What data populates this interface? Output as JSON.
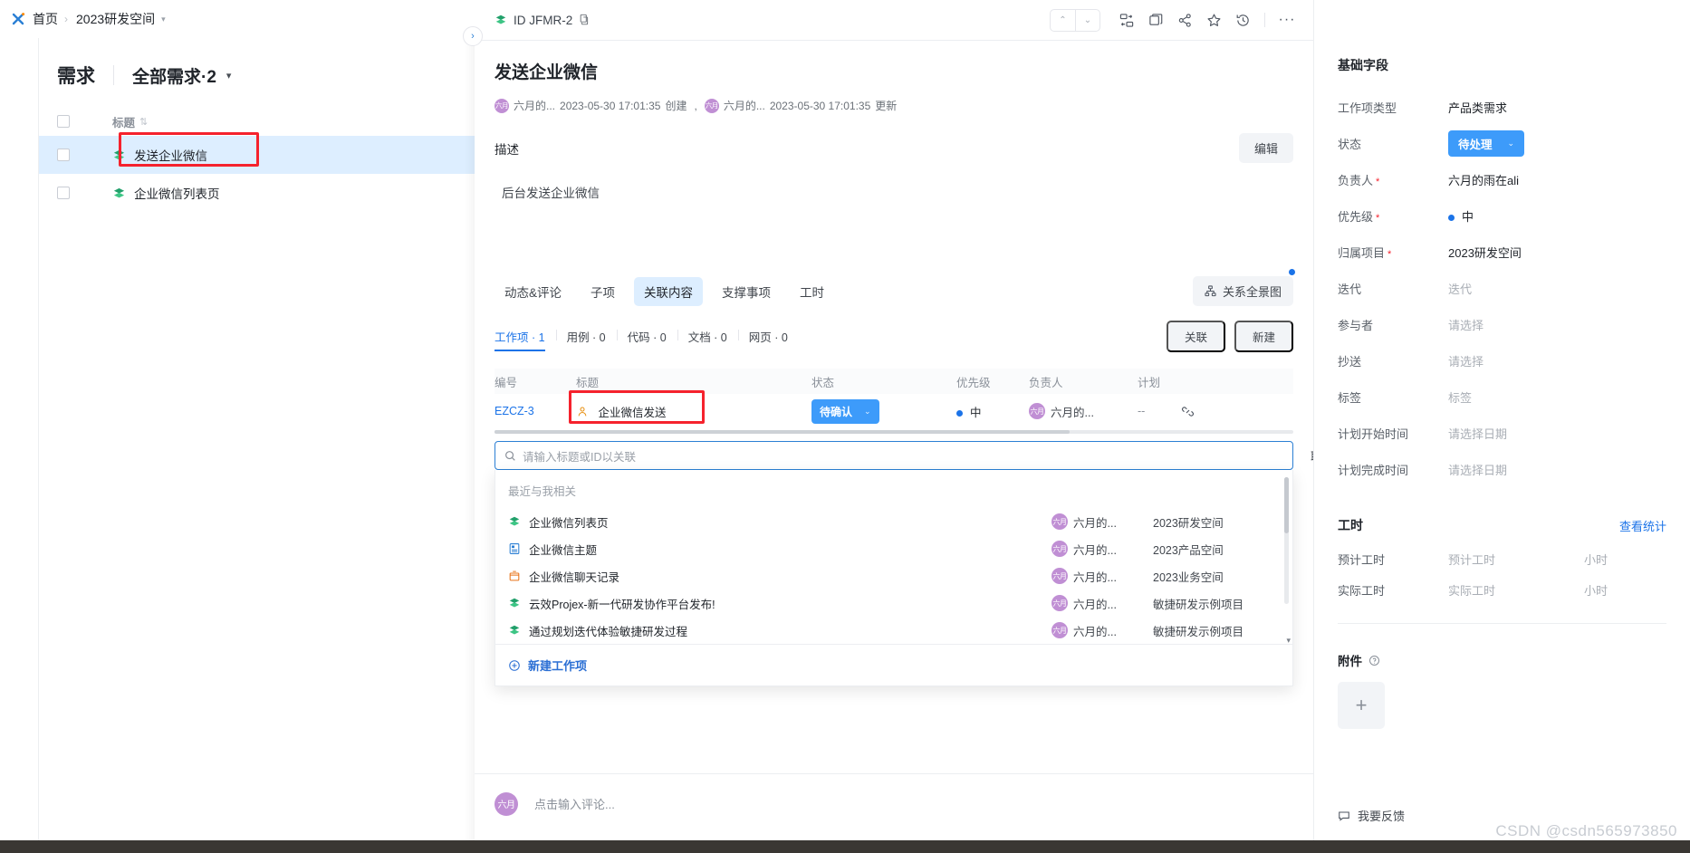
{
  "breadcrumb": {
    "home": "首页",
    "sep": "›",
    "space": "2023研发空间",
    "caret": "▾"
  },
  "left_list": {
    "title": "需求",
    "view_name": "全部需求·2",
    "view_caret": "▾",
    "column_header": "标题",
    "sort_icon": "⇅",
    "items": [
      {
        "name": "发送企业微信",
        "icon": "layers-icon",
        "selected": true,
        "highlighted": true
      },
      {
        "name": "企业微信列表页",
        "icon": "layers-icon",
        "selected": false,
        "highlighted": false
      }
    ]
  },
  "expander": {
    "icon": "›"
  },
  "detail": {
    "id_label": "ID JFMR-2",
    "copy_icon": "copy-icon",
    "toolbar": {
      "prev": "⌃",
      "next": "⌄",
      "icons": [
        "convert-icon",
        "duplicate-icon",
        "share-icon",
        "star-icon",
        "history-icon",
        "more-icon"
      ],
      "more": "···"
    },
    "title": "发送企业微信",
    "meta": {
      "creator": "六月的...",
      "created_time": "2023-05-30 17:01:35",
      "created_suffix": "创建",
      "comma": ",",
      "updater": "六月的...",
      "updated_time": "2023-05-30 17:01:35",
      "updated_suffix": "更新",
      "avatar_text": "六月"
    },
    "description": {
      "label": "描述",
      "edit_button": "编辑",
      "body": "后台发送企业微信"
    },
    "tabs": [
      {
        "label": "动态&评论",
        "active": false
      },
      {
        "label": "子项",
        "active": false
      },
      {
        "label": "关联内容",
        "active": true
      },
      {
        "label": "支撑事项",
        "active": false
      },
      {
        "label": "工时",
        "active": false
      }
    ],
    "panorama_button": "关系全景图",
    "subtabs": [
      {
        "label": "工作项 · 1",
        "active": true
      },
      {
        "label": "用例 · 0",
        "active": false
      },
      {
        "label": "代码 · 0",
        "active": false
      },
      {
        "label": "文档 · 0",
        "active": false
      },
      {
        "label": "网页 · 0",
        "active": false
      }
    ],
    "subtab_actions": {
      "link": "关联",
      "create": "新建"
    },
    "related_table": {
      "columns": [
        "编号",
        "标题",
        "状态",
        "优先级",
        "负责人",
        "计划"
      ],
      "rows": [
        {
          "id": "EZCZ-3",
          "title": "企业微信发送",
          "title_icon": "person-task-icon",
          "status": "待确认",
          "status_caret": "⌄",
          "priority": "中",
          "owner": "六月的...",
          "owner_avatar": "六月",
          "plan": "--",
          "unlink_icon": "unlink-icon",
          "highlighted": true
        }
      ]
    },
    "search": {
      "icon": "search-icon",
      "placeholder": "请输入标题或ID以关联",
      "cancel": "取消"
    },
    "dropdown": {
      "header": "最近与我相关",
      "items": [
        {
          "icon": "layers-icon",
          "name": "企业微信列表页",
          "owner": "六月的...",
          "owner_avatar": "六月",
          "project": "2023研发空间"
        },
        {
          "icon": "doc-blue-icon",
          "name": "企业微信主题",
          "owner": "六月的...",
          "owner_avatar": "六月",
          "project": "2023产品空间"
        },
        {
          "icon": "box-orange-icon",
          "name": "企业微信聊天记录",
          "owner": "六月的...",
          "owner_avatar": "六月",
          "project": "2023业务空间"
        },
        {
          "icon": "layers-icon",
          "name": "云效Projex-新一代研发协作平台发布!",
          "owner": "六月的...",
          "owner_avatar": "六月",
          "project": "敏捷研发示例项目"
        },
        {
          "icon": "layers-icon",
          "name": "通过规划迭代体验敏捷研发过程",
          "owner": "六月的...",
          "owner_avatar": "六月",
          "project": "敏捷研发示例项目"
        }
      ],
      "footer": {
        "icon": "plus-circle-icon",
        "label": "新建工作项"
      },
      "scroll_arrow": "▾"
    },
    "comment": {
      "avatar": "六月",
      "placeholder": "点击输入评论..."
    }
  },
  "sidebar": {
    "section_basic": "基础字段",
    "fields": [
      {
        "label": "工作项类型",
        "value": "产品类需求",
        "required": false,
        "placeholder": false
      },
      {
        "label": "状态",
        "value": "待处理",
        "required": false,
        "type": "status-pill",
        "caret": "⌄"
      },
      {
        "label": "负责人",
        "value": "六月的雨在ali",
        "required": true,
        "placeholder": false
      },
      {
        "label": "优先级",
        "value": "中",
        "required": true,
        "type": "priority"
      },
      {
        "label": "归属项目",
        "value": "2023研发空间",
        "required": true,
        "placeholder": false
      },
      {
        "label": "迭代",
        "value": "迭代",
        "required": false,
        "placeholder": true
      },
      {
        "label": "参与者",
        "value": "请选择",
        "required": false,
        "placeholder": true
      },
      {
        "label": "抄送",
        "value": "请选择",
        "required": false,
        "placeholder": true
      },
      {
        "label": "标签",
        "value": "标签",
        "required": false,
        "placeholder": true
      },
      {
        "label": "计划开始时间",
        "value": "请选择日期",
        "required": false,
        "placeholder": true
      },
      {
        "label": "计划完成时间",
        "value": "请选择日期",
        "required": false,
        "placeholder": true
      }
    ],
    "worktime": {
      "title": "工时",
      "action": "查看统计",
      "rows": [
        {
          "label": "预计工时",
          "placeholder": "预计工时",
          "unit": "小时"
        },
        {
          "label": "实际工时",
          "placeholder": "实际工时",
          "unit": "小时"
        }
      ]
    },
    "attachment": {
      "title": "附件",
      "help_icon": "question-icon",
      "add": "+"
    },
    "feedback": {
      "icon": "feedback-icon",
      "label": "我要反馈"
    }
  },
  "watermark": "CSDN @csdn565973850"
}
